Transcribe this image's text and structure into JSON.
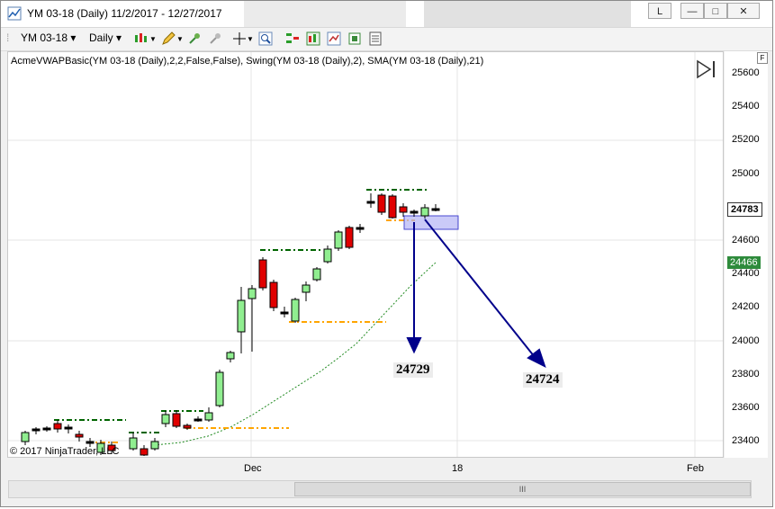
{
  "window": {
    "title": "YM 03-18 (Daily)  11/2/2017 - 12/27/2017",
    "controls": {
      "link": "L",
      "minimize": "—",
      "maximize": "□",
      "close": "✕"
    }
  },
  "toolbar": {
    "instrument": "YM 03-18",
    "interval": "Daily"
  },
  "chart": {
    "indicators_label": "AcmeVWAPBasic(YM 03-18 (Daily),2,2,False,False), Swing(YM 03-18 (Daily),2), SMA(YM 03-18 (Daily),21)",
    "y_ticks": [
      "25600",
      "25400",
      "25200",
      "25000",
      "24800",
      "24600",
      "24400",
      "24200",
      "24000",
      "23800",
      "23600",
      "23400"
    ],
    "x_ticks": [
      "Dec",
      "18",
      "Feb"
    ],
    "last_price": "24783",
    "sma_price": "24466",
    "copyright": "© 2017 NinjaTrader, LLC",
    "annotations": [
      "24729",
      "24724"
    ],
    "panel_marker": "F",
    "scroll_grip": "III"
  },
  "colors": {
    "up_candle": "#90ee90",
    "down_candle": "#e00000",
    "swing_high": "#006400",
    "swing_low": "#ffa500",
    "sma": "#228b22",
    "arrow": "#00008b",
    "zone": "#b0b0f0",
    "sma_tag": "#2e8b3c"
  }
}
